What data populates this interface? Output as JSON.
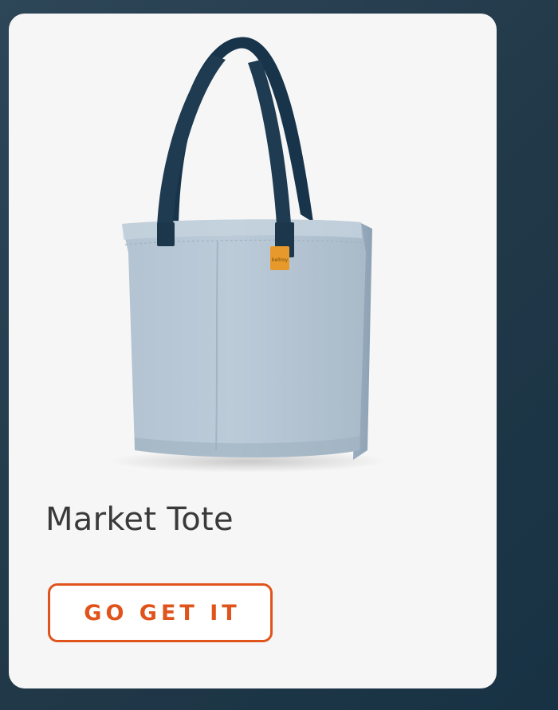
{
  "product": {
    "name": "Market Tote",
    "image_icon": "tote-bag-image",
    "tag_text": "bellroy",
    "colors": {
      "bag_body": "#b9c8d6",
      "straps": "#1d3a4f",
      "tag": "#e79a2b"
    }
  },
  "cta": {
    "label": "GO GET IT",
    "accent_color": "#e0541c"
  }
}
